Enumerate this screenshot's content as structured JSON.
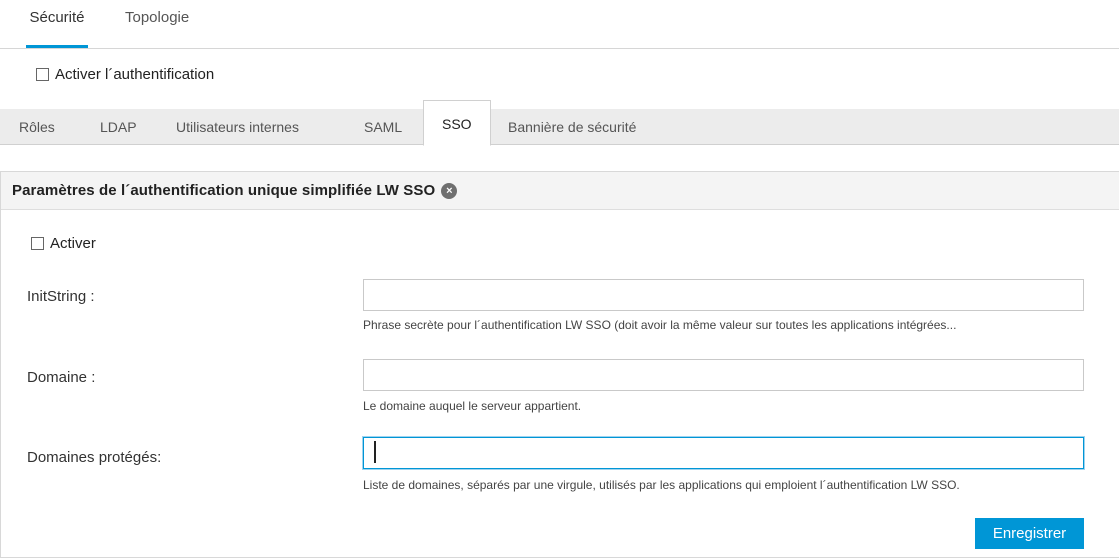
{
  "top_tabs": [
    {
      "label": "Sécurité",
      "active": true
    },
    {
      "label": "Topologie",
      "active": false
    }
  ],
  "enable_auth": {
    "label": "Activer l´authentification",
    "checked": false
  },
  "sub_tabs": [
    {
      "label": "Rôles",
      "active": false
    },
    {
      "label": "LDAP",
      "active": false
    },
    {
      "label": "Utilisateurs internes",
      "active": false
    },
    {
      "label": "SAML",
      "active": false
    },
    {
      "label": "SSO",
      "active": true
    },
    {
      "label": "Bannière de sécurité",
      "active": false
    }
  ],
  "panel": {
    "title": "Paramètres de l´authentification unique simplifiée LW SSO",
    "clear_icon": "×",
    "enable": {
      "label": "Activer",
      "checked": false
    },
    "fields": [
      {
        "label": "InitString :",
        "value": "",
        "help": "Phrase secrète pour l´authentification LW SSO (doit avoir la même valeur sur toutes les applications intégrées..."
      },
      {
        "label": "Domaine :",
        "value": "",
        "help": "Le domaine auquel le serveur appartient."
      },
      {
        "label": "Domaines protégés:",
        "value": "",
        "help": "Liste de domaines, séparés par une virgule, utilisés par les applications qui emploient l´authentification LW SSO."
      }
    ],
    "save_label": "Enregistrer"
  },
  "colors": {
    "accent": "#0096d6",
    "tab_bar_bg": "#ececec",
    "panel_header_bg": "#f4f4f4"
  }
}
